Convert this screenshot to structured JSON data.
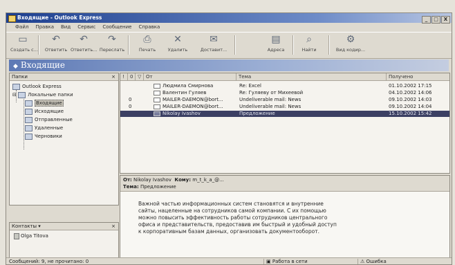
{
  "window": {
    "title": "Входящие - Outlook Express",
    "buttons": [
      "_",
      "□",
      "X"
    ]
  },
  "menu": [
    "Файл",
    "Правка",
    "Вид",
    "Сервис",
    "Сообщение",
    "Справка"
  ],
  "toolbar": [
    {
      "label": "Создать с...",
      "icon": "create-mail-icon"
    },
    {
      "label": "Ответить",
      "icon": "reply-icon"
    },
    {
      "label": "Ответить...",
      "icon": "reply-all-icon"
    },
    {
      "label": "Переслать",
      "icon": "forward-icon"
    },
    {
      "label": "Печать",
      "icon": "print-icon"
    },
    {
      "label": "Удалить",
      "icon": "delete-icon"
    },
    {
      "label": "Доставит...",
      "icon": "send-receive-icon"
    },
    {
      "label": "Адреса",
      "icon": "address-book-icon"
    },
    {
      "label": "Найти",
      "icon": "find-icon"
    },
    {
      "label": "Вид кодир...",
      "icon": "encoding-icon"
    }
  ],
  "banner": {
    "title": "Входящие"
  },
  "folders": {
    "header": "Папки",
    "close": "×",
    "items": [
      {
        "label": "Outlook Express",
        "icon": "outlook-express-icon"
      },
      {
        "label": "Локальные папки",
        "icon": "local-folders-icon"
      },
      {
        "label": "Входящие",
        "icon": "inbox-icon"
      },
      {
        "label": "Исходящие",
        "icon": "outbox-icon"
      },
      {
        "label": "Отправленные",
        "icon": "sent-items-icon"
      },
      {
        "label": "Удаленные",
        "icon": "deleted-items-icon"
      },
      {
        "label": "Черновики",
        "icon": "drafts-icon"
      }
    ]
  },
  "contacts": {
    "header": "Контакты ▾",
    "close": "×",
    "items": [
      "Olga Titova"
    ]
  },
  "list": {
    "columns": [
      "!",
      "0",
      "▽",
      "От",
      "Тема",
      "Получено"
    ],
    "rows": [
      {
        "attach": "",
        "from": "Людмила Смирнова",
        "subject": "Re: Excel",
        "received": "01.10.2002 17:15"
      },
      {
        "attach": "",
        "from": "Валентин Гуляев",
        "subject": "Re: Гуляеву от Михеевой",
        "received": "04.10.2002 14:06"
      },
      {
        "attach": "0",
        "from": "MAILER-DAEMON@bort...",
        "subject": "Undeliverable mail: News",
        "received": "09.10.2002 14:03"
      },
      {
        "attach": "0",
        "from": "MAILER-DAEMON@bort...",
        "subject": "Undeliverable mail: News",
        "received": "09.10.2002 14:04"
      },
      {
        "attach": "",
        "from": "Nikolay Ivashov",
        "subject": "Предложение",
        "received": "15.10.2002 15:42"
      }
    ]
  },
  "preview": {
    "from_label": "От:",
    "from": "Nikolay Ivashov",
    "to_label": "Кому:",
    "to": "m_t_k_a_@...",
    "subject_label": "Тема:",
    "subject": "Предложение",
    "body": [
      "Важной частью информационных систем становятся и внутренние",
      "сайты, нацеленные на сотрудников самой компании. С их помощью",
      "можно повысить эффективность работы сотрудников центрального",
      "офиса и представительств, предоставив им быстрый и удобный доступ",
      "к корпоративным базам данных, организовать документооборот."
    ]
  },
  "status": {
    "messages": "Сообщений: 9, не прочитано: 0",
    "mode": "Работа в сети",
    "error": "Ошибка"
  }
}
